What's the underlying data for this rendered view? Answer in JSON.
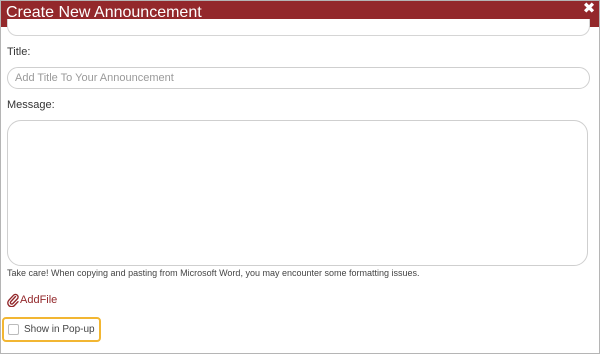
{
  "dialog": {
    "title": "Create New Announcement",
    "close_icon": "close-icon"
  },
  "form": {
    "title_label": "Title:",
    "title_placeholder": "Add Title To Your Announcement",
    "title_value": "",
    "message_label": "Message:",
    "message_value": "",
    "warning_text": "Take care! When copying and pasting from Microsoft Word, you may encounter some formatting issues.",
    "add_file_label": "AddFile",
    "add_file_icon": "paperclip-icon",
    "popup_label": "Show in Pop-up",
    "popup_checked": false
  },
  "colors": {
    "header_bg": "#93282b",
    "accent": "#93282b",
    "highlight": "#f2b632"
  }
}
